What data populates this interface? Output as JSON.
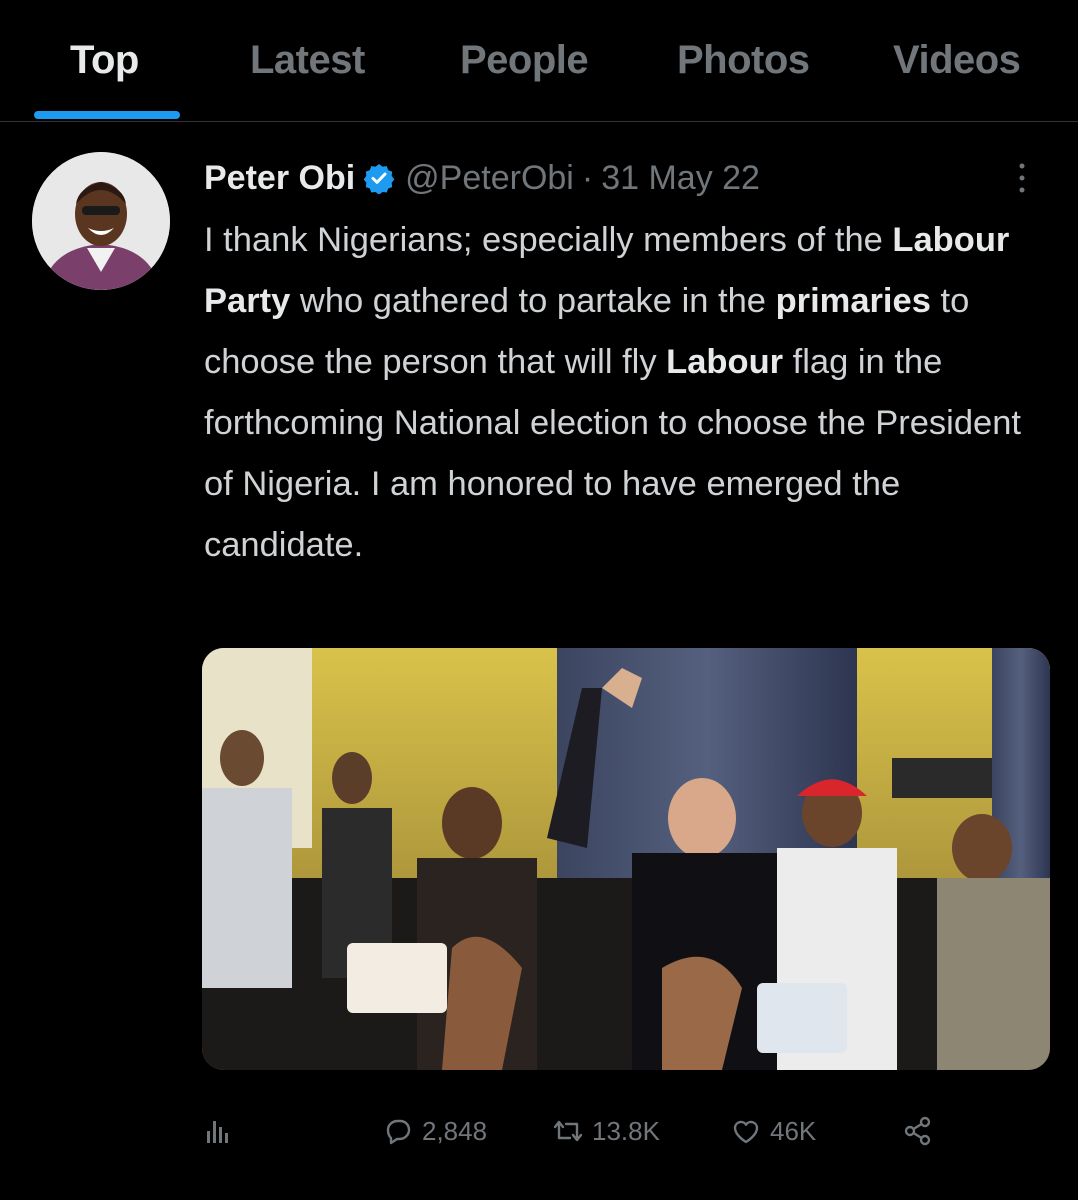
{
  "tabs": [
    {
      "label": "Top",
      "active": true
    },
    {
      "label": "Latest",
      "active": false
    },
    {
      "label": "People",
      "active": false
    },
    {
      "label": "Photos",
      "active": false
    },
    {
      "label": "Videos",
      "active": false
    }
  ],
  "tweet": {
    "author_name": "Peter Obi",
    "handle": "@PeterObi",
    "separator": "·",
    "date": "31 May 22",
    "text_parts": [
      {
        "t": "I thank Nigerians; especially members of the ",
        "bold": false
      },
      {
        "t": "Labour Party",
        "bold": true
      },
      {
        "t": " who gathered to partake in the ",
        "bold": false
      },
      {
        "t": "primaries",
        "bold": true
      },
      {
        "t": " to choose the person that will fly ",
        "bold": false
      },
      {
        "t": "Labour",
        "bold": true
      },
      {
        "t": " flag in the forthcoming National election to choose the President of Nigeria. I am honored to have emerged the candidate.",
        "bold": false
      }
    ],
    "stats": {
      "replies": "2,848",
      "retweets": "13.8K",
      "likes": "46K"
    }
  },
  "icons": {
    "verified": "verified-badge-icon",
    "more": "more-options-icon",
    "analytics": "analytics-icon",
    "reply": "reply-icon",
    "retweet": "retweet-icon",
    "like": "heart-icon",
    "share": "share-icon"
  },
  "colors": {
    "background": "#000000",
    "accent": "#1d9bf0",
    "muted_text": "#71767b",
    "primary_text": "#e7e9ea"
  }
}
